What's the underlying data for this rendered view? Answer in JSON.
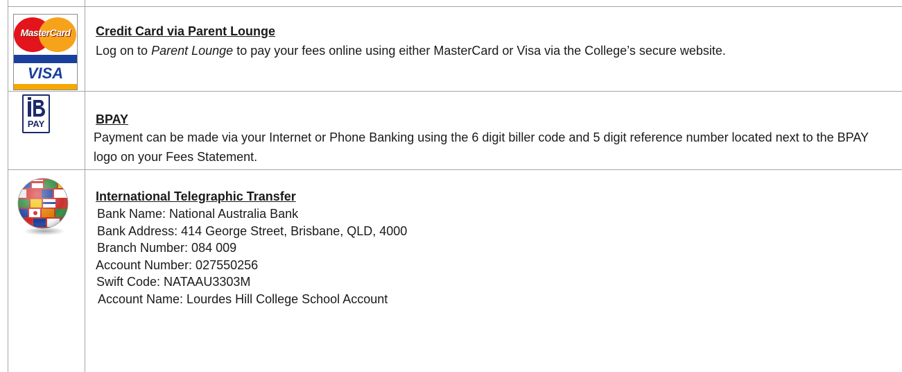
{
  "rows": [
    {
      "icon": "mastercard-visa-logo",
      "heading": "Credit Card via Parent Lounge",
      "text_pre": "Log on to ",
      "text_italic": "Parent Lounge",
      "text_post": " to pay your fees online using either MasterCard or Visa via the College’s secure website.",
      "logo_text_top": "MasterCard",
      "logo_text_bottom": "VISA"
    },
    {
      "icon": "bpay-logo",
      "heading": "BPAY",
      "text": "Payment can be made via your Internet or Phone Banking using the 6 digit biller code and 5 digit reference number located next to the BPAY logo on your Fees Statement.",
      "logo_text": "PAY"
    },
    {
      "icon": "globe-flags-icon",
      "heading": "International Telegraphic Transfer",
      "lines": [
        "Bank Name:  National Australia Bank",
        "Bank Address:  414 George Street, Brisbane, QLD, 4000",
        "Branch Number:  084 009",
        "Account Number:  027550256",
        "Swift Code:  NATAAU3303M",
        "Account Name:  Lourdes Hill College School Account"
      ]
    }
  ],
  "colors": {
    "grid": "#a6a6a6",
    "mastercard_red": "#e3141b",
    "mastercard_orange": "#f7a21b",
    "visa_blue": "#1a3f9c",
    "visa_gold": "#f6a800",
    "bpay_navy": "#1d2a6b"
  }
}
